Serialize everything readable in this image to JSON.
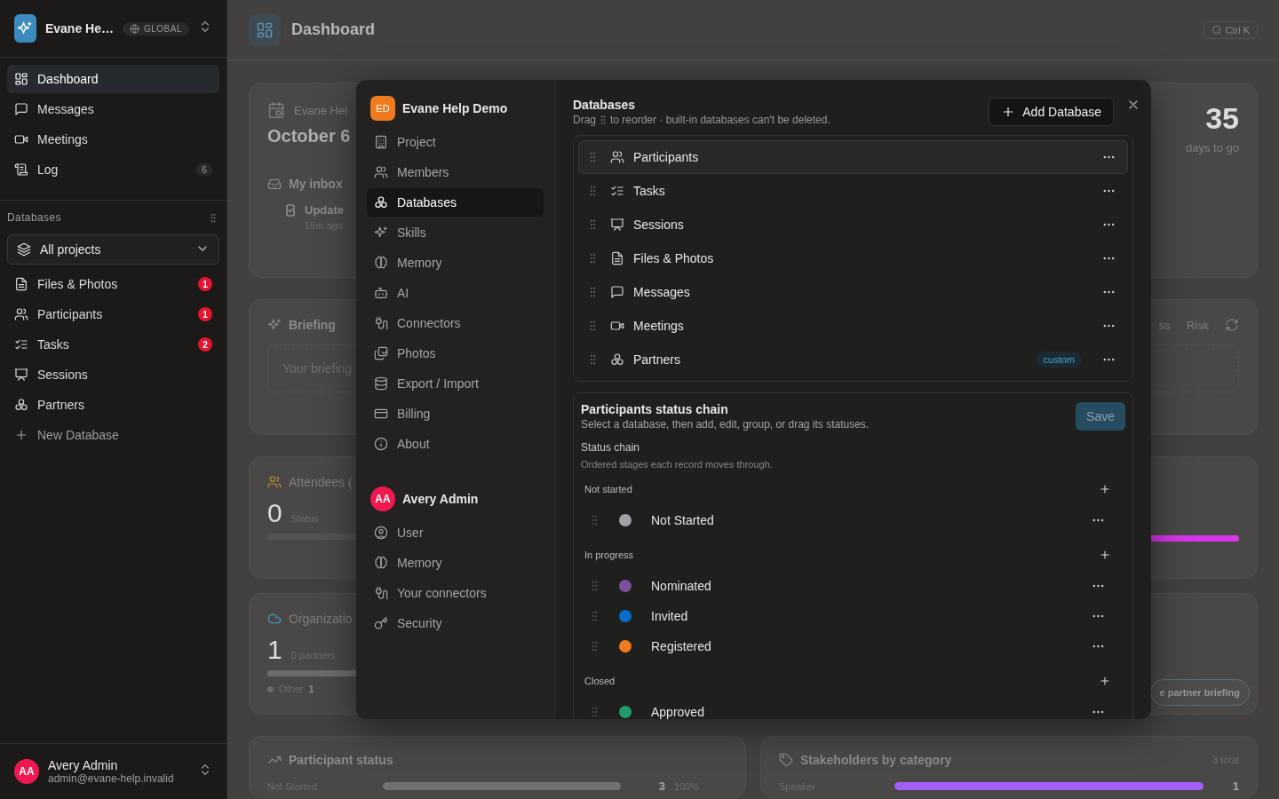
{
  "sidebar": {
    "workspace": {
      "name": "Evane He…",
      "scope": "GLOBAL"
    },
    "nav": [
      {
        "label": "Dashboard",
        "selected": true
      },
      {
        "label": "Messages",
        "selected": false
      },
      {
        "label": "Meetings",
        "selected": false
      },
      {
        "label": "Log",
        "selected": false,
        "count": "6"
      }
    ],
    "databases_heading": "Databases",
    "project_filter": "All projects",
    "databases": [
      {
        "label": "Files & Photos",
        "alert_count": "1"
      },
      {
        "label": "Participants",
        "alert_count": "1"
      },
      {
        "label": "Tasks",
        "alert_count": "2"
      },
      {
        "label": "Sessions"
      },
      {
        "label": "Partners"
      }
    ],
    "new_database": "New Database",
    "user": {
      "initials": "AA",
      "name": "Avery Admin",
      "email": "admin@evane-help.invalid"
    }
  },
  "main": {
    "header": {
      "title": "Dashboard",
      "search_shortcut": "Ctrl K"
    },
    "overview": {
      "event": "Evane Hel",
      "date": "October 6",
      "inbox_title": "My inbox",
      "inbox_item": "Update",
      "inbox_time": "15m ago",
      "countdown": "35",
      "countdown_label": "days to go"
    },
    "briefing": {
      "title": "Briefing",
      "tabs": [
        "ss",
        "Risk"
      ],
      "placeholder": "Your briefing"
    },
    "attendees": {
      "title": "Attendees (",
      "value": "0",
      "caption": "Status"
    },
    "highlight": {
      "level": 1
    },
    "organizations": {
      "title": "Organizatio",
      "value": "1",
      "caption": "0 partners",
      "level": 1,
      "legend": [
        {
          "label": "Other",
          "count": "1"
        }
      ]
    },
    "partner_button": "e partner briefing",
    "participant_status": {
      "title": "Participant status",
      "rows": [
        {
          "label": "Not Started",
          "level": 1,
          "count": "3",
          "percent": "100%"
        }
      ]
    },
    "stakeholders": {
      "title": "Stakeholders by category",
      "total": "3 total",
      "rows": [
        {
          "label": "Speaker",
          "level": 1,
          "count": "1"
        }
      ]
    }
  },
  "modal": {
    "workspace": {
      "initials": "ED",
      "name": "Evane Help Demo",
      "items": [
        {
          "label": "Project",
          "selected": false
        },
        {
          "label": "Members",
          "selected": false
        },
        {
          "label": "Databases",
          "selected": true
        },
        {
          "label": "Skills",
          "selected": false
        },
        {
          "label": "Memory",
          "selected": false
        },
        {
          "label": "AI",
          "selected": false
        },
        {
          "label": "Connectors",
          "selected": false
        },
        {
          "label": "Photos",
          "selected": false
        },
        {
          "label": "Export / Import",
          "selected": false
        },
        {
          "label": "Billing",
          "selected": false
        },
        {
          "label": "About",
          "selected": false
        }
      ]
    },
    "account": {
      "initials": "AA",
      "name": "Avery Admin",
      "items": [
        {
          "label": "User",
          "selected": false
        },
        {
          "label": "Memory",
          "selected": false
        },
        {
          "label": "Your connectors",
          "selected": false
        },
        {
          "label": "Security",
          "selected": false
        }
      ]
    },
    "title": "Databases",
    "hint_before": "Drag",
    "hint_after": "to reorder · built-in databases can't be deleted.",
    "add_button": "Add Database",
    "databases": [
      {
        "label": "Participants",
        "selected": true
      },
      {
        "label": "Tasks",
        "selected": false
      },
      {
        "label": "Sessions",
        "selected": false
      },
      {
        "label": "Files & Photos",
        "selected": false
      },
      {
        "label": "Messages",
        "selected": false
      },
      {
        "label": "Meetings",
        "selected": false
      },
      {
        "label": "Partners",
        "selected": false,
        "tag": "custom"
      }
    ],
    "chain": {
      "title": "Participants status chain",
      "subtitle": "Select a database, then add, edit, group, or drag its statuses.",
      "save": {
        "label": "Save",
        "disabled": true
      },
      "heading": "Status chain",
      "description": "Ordered stages each record moves through.",
      "groups": [
        {
          "label": "Not started",
          "statuses": [
            {
              "label": "Not Started",
              "color": "#a1a1aa"
            }
          ]
        },
        {
          "label": "In progress",
          "statuses": [
            {
              "label": "Nominated",
              "color": "#7b4f9c"
            },
            {
              "label": "Invited",
              "color": "#0a6bc9"
            },
            {
              "label": "Registered",
              "color": "#f07a1e"
            }
          ]
        },
        {
          "label": "Closed",
          "statuses": [
            {
              "label": "Approved",
              "color": "#1f9e6b"
            }
          ]
        }
      ]
    }
  }
}
